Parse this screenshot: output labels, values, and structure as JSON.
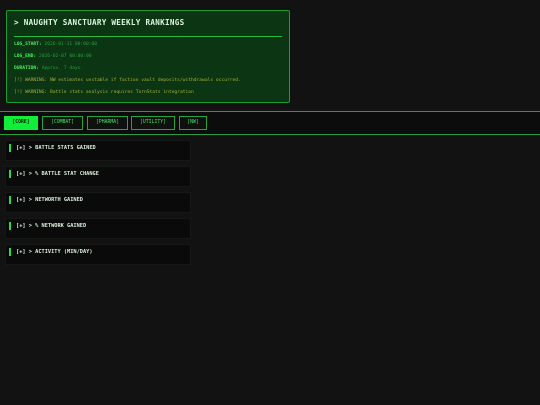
{
  "header": {
    "title": "> NAUGHTY SANCTUARY WEEKLY RANKINGS",
    "log_start_label": "LOG_START:",
    "log_start_value": "2026-01-31 00:00:00",
    "log_end_label": "LOG_END:",
    "log_end_value": "2026-02-07 00:00:00",
    "duration_label": "DURATION:",
    "duration_value": "Approx. 7 days.",
    "warnings": [
      "[!] WARNING: NW estimates unstable if faction vault deposits/withdrawals occurred.",
      "[!] WARNING: Battle stats analysis requires TornStats integration"
    ]
  },
  "tabs": [
    {
      "label": "[CORE]",
      "active": true
    },
    {
      "label": "[COMBAT]",
      "active": false
    },
    {
      "label": "[PHARMA]",
      "active": false
    },
    {
      "label": "[UTILITY]",
      "active": false
    },
    {
      "label": "[NW]",
      "active": false
    }
  ],
  "sections": [
    {
      "label": "[+] > BATTLE STATS GAINED"
    },
    {
      "label": "[+] > % BATTLE STAT CHANGE"
    },
    {
      "label": "[+] > NETWORTH GAINED"
    },
    {
      "label": "[+] > % NETWORK GAINED"
    },
    {
      "label": "[+] > ACTIVITY (MIN/DAY)"
    }
  ],
  "colors": {
    "accent": "#10ee3a",
    "panel_bg": "#0b3513",
    "warning": "#a7b13a",
    "page_bg": "#111211"
  }
}
